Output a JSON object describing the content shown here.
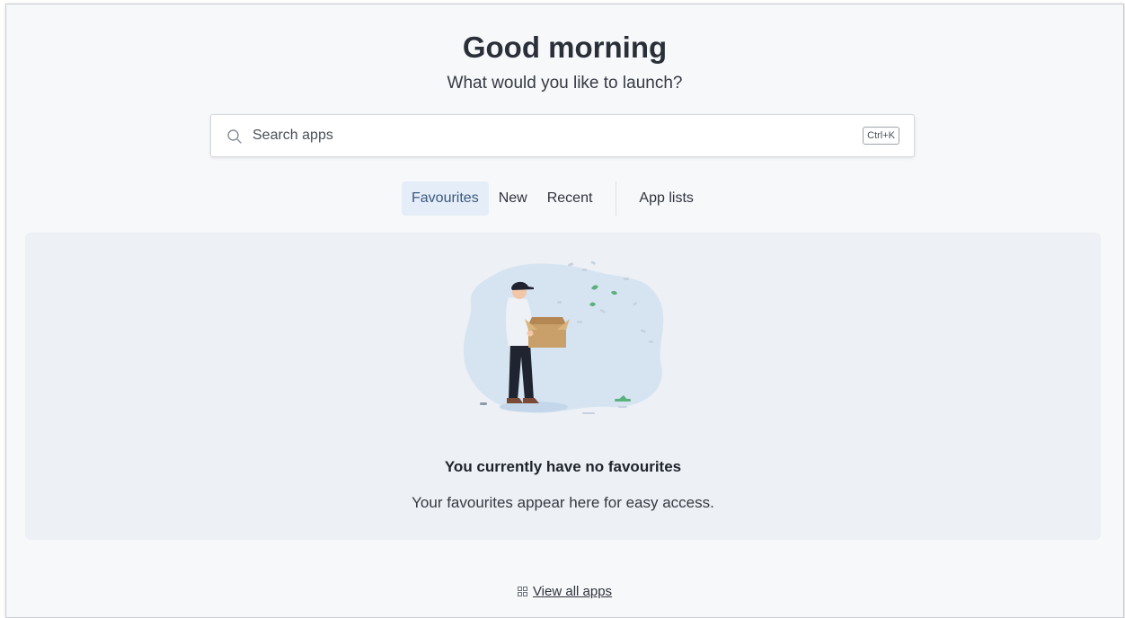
{
  "header": {
    "greeting": "Good morning",
    "subtitle": "What would you like to launch?"
  },
  "search": {
    "placeholder": "Search apps",
    "value": "",
    "shortcut": "Ctrl+K",
    "icon": "search-icon"
  },
  "tabs": [
    {
      "label": "Favourites",
      "active": true
    },
    {
      "label": "New",
      "active": false
    },
    {
      "label": "Recent",
      "active": false
    },
    {
      "label": "App lists",
      "active": false
    }
  ],
  "empty_state": {
    "title": "You currently have no favourites",
    "description": "Your favourites appear here for easy access.",
    "illustration": "person-holding-box-illustration"
  },
  "footer": {
    "view_all_label": "View all apps",
    "icon": "grid-icon"
  },
  "colors": {
    "page_background": "#f7f8fa",
    "panel_background": "#edf0f4",
    "active_tab_background": "#e5edf8",
    "illustration_blob": "#d6e4f2",
    "leaf_green": "#5bb07d",
    "box_tan": "#c9a06a"
  }
}
